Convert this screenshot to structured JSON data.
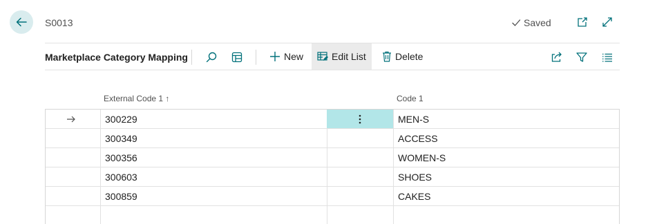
{
  "header": {
    "record_id": "S0013",
    "saved_label": "Saved"
  },
  "action_bar": {
    "page_title": "Marketplace Category Mapping",
    "new_label": "New",
    "edit_list_label": "Edit List",
    "delete_label": "Delete"
  },
  "grid": {
    "columns": [
      "External Code 1",
      "Code 1"
    ],
    "sort_indicator": "↑",
    "rows": [
      {
        "external_code": "300229",
        "code": "MEN-S",
        "selected": true
      },
      {
        "external_code": "300349",
        "code": "ACCESS"
      },
      {
        "external_code": "300356",
        "code": "WOMEN-S"
      },
      {
        "external_code": "300603",
        "code": "SHOES"
      },
      {
        "external_code": "300859",
        "code": "CAKES"
      }
    ]
  },
  "colors": {
    "accent": "#00a3a8",
    "selected_cell": "#b2e6e8",
    "back_button_bg": "#d9ecee"
  }
}
